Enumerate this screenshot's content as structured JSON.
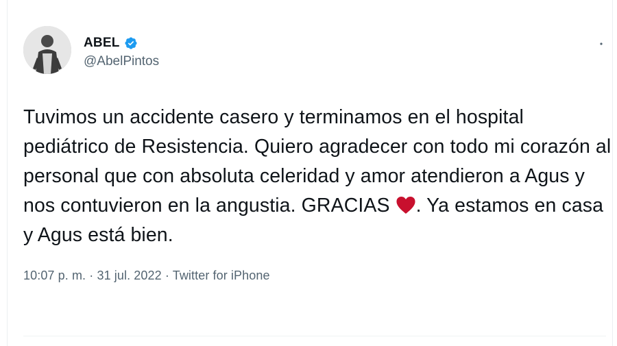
{
  "author": {
    "display_name": "ABEL",
    "handle": "@AbelPintos",
    "verified": true
  },
  "tweet": {
    "text_before_heart": "Tuvimos un accidente casero y terminamos en el hospital pediátrico de Resistencia. Quiero agradecer con todo mi corazón al personal que con absoluta celeridad y amor atendieron a Agus y nos contuvieron en la angustia. GRACIAS ",
    "text_after_heart": ". Ya estamos en casa y Agus está bien."
  },
  "meta": {
    "time": "10:07 p. m.",
    "separator1": " · ",
    "date": "31 jul. 2022",
    "separator2": " · ",
    "source": "Twitter for iPhone"
  },
  "icons": {
    "verified": "verified-badge-icon",
    "heart": "red-heart-icon",
    "more": "more-dots-icon"
  },
  "colors": {
    "verified_blue": "#1d9bf0",
    "heart_red": "#c8102e",
    "secondary_text": "#536471",
    "primary_text": "#0f1419"
  }
}
